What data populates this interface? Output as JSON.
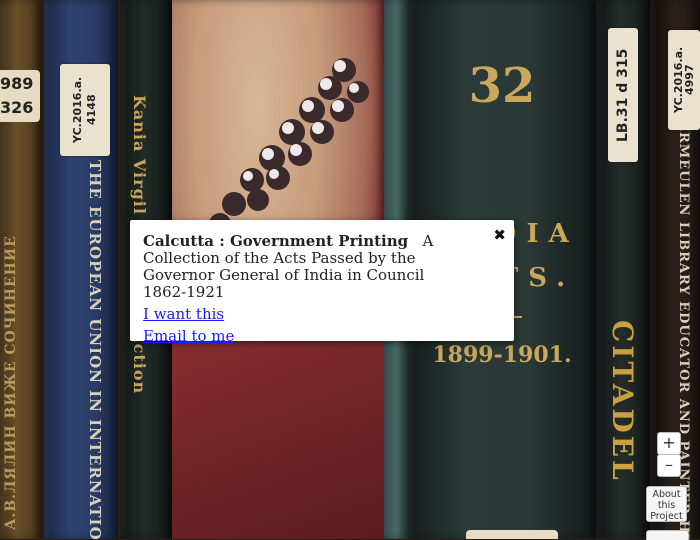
{
  "books": [
    {
      "spine_text": "А.В.ЛЯЛИН   ВИЖЕ СОЧИНЕНИЕ",
      "color": "#5a4321"
    },
    {
      "call_number": "989 326"
    },
    {
      "call_number": "YC.2016.a. 4148",
      "spine_text": "THE EUROPEAN UNION IN INTERNATIONAL ORGANISATIONS AND GLOBAL GOVERNANCE",
      "color": "#27385c"
    },
    {
      "spine_text": "Kania   Virgil   the Art of Fiction",
      "color": "#19211f"
    },
    {
      "color": "#7d2d2f"
    },
    {
      "color": "#3a5a58"
    },
    {
      "spine_top": "32",
      "spine_title": "INDIA ACTS.",
      "spine_years": "1899-1901.",
      "color": "#243130"
    },
    {
      "call_number": "LB.31 d 315",
      "spine_text": "CITADEL",
      "color": "#1c2220"
    },
    {
      "call_number": "YC.2016.a. 4997",
      "spine_text": "VERMEULEN   LIBRARY EDUCATOR AND PAINTER   HENRI",
      "color": "#1c1612"
    }
  ],
  "popup": {
    "title": "Calcutta : Government Printing",
    "description": "A Collection of the Acts Passed by the Governor General of India in Council",
    "years": "1862-1921",
    "link_want": "I want this",
    "link_email": "Email to me",
    "close_symbol": "✖"
  },
  "controls": {
    "zoom_in": "+",
    "zoom_out": "–",
    "about": [
      "About",
      "this",
      "Project"
    ]
  }
}
